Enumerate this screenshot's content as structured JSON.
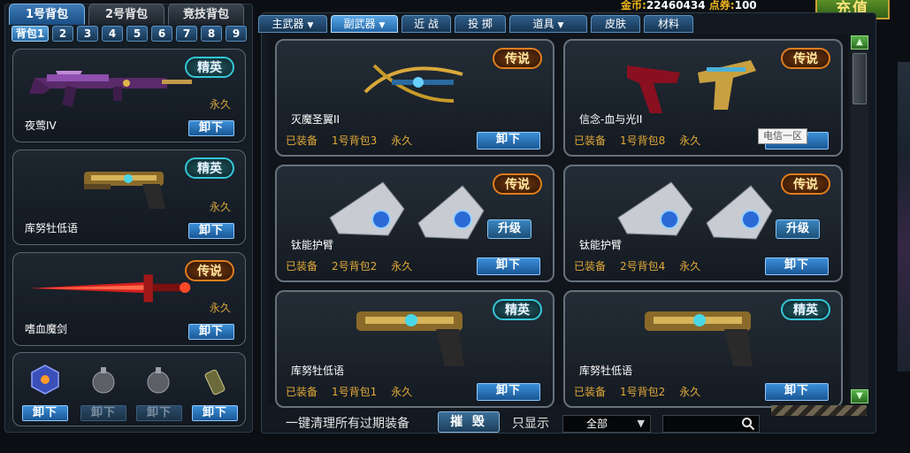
{
  "currency": {
    "gold_label": "金币:",
    "gold_value": "22460434",
    "points_label": "点券:",
    "points_value": "100",
    "topup_label": "充值"
  },
  "bag_tabs": [
    "1号背包",
    "2号背包",
    "竞技背包"
  ],
  "slot_tabs": [
    "背包1",
    "2",
    "3",
    "4",
    "5",
    "6",
    "7",
    "8",
    "9"
  ],
  "equipped": [
    {
      "name": "夜莺IV",
      "badge": "精英",
      "duration": "永久",
      "button": "卸下"
    },
    {
      "name": "库努牡低语",
      "badge": "精英",
      "duration": "永久",
      "button": "卸下"
    },
    {
      "name": "嗜血魔剑",
      "badge": "传说",
      "duration": "永久",
      "button": "卸下"
    }
  ],
  "throwables": {
    "buttons": [
      "卸下",
      "卸下",
      "卸下",
      "卸下"
    ]
  },
  "category_tabs": [
    {
      "label": "主武器",
      "has_arrow": true
    },
    {
      "label": "副武器",
      "has_arrow": true
    },
    {
      "label": "近 战",
      "has_arrow": false
    },
    {
      "label": "投 掷",
      "has_arrow": false
    },
    {
      "label": "道具",
      "has_arrow": true
    },
    {
      "label": "皮肤",
      "has_arrow": false
    },
    {
      "label": "材料",
      "has_arrow": false
    }
  ],
  "cards": [
    {
      "name": "灭魔圣翼II",
      "badge": "传说",
      "status": "已装备",
      "bag": "1号背包3",
      "duration": "永久",
      "button": "卸下"
    },
    {
      "name": "信念-血与光II",
      "badge": "传说",
      "status": "已装备",
      "bag": "1号背包8",
      "duration": "永久",
      "button": "卸下"
    },
    {
      "name": "钛能护臂",
      "badge": "传说",
      "status": "已装备",
      "bag": "2号背包2",
      "duration": "永久",
      "button": "卸下",
      "upgrade": "升级"
    },
    {
      "name": "钛能护臂",
      "badge": "传说",
      "status": "已装备",
      "bag": "2号背包4",
      "duration": "永久",
      "button": "卸下",
      "upgrade": "升级"
    },
    {
      "name": "库努牡低语",
      "badge": "精英",
      "status": "已装备",
      "bag": "1号背包1",
      "duration": "永久",
      "button": "卸下"
    },
    {
      "name": "库努牡低语",
      "badge": "精英",
      "status": "已装备",
      "bag": "1号背包2",
      "duration": "永久",
      "button": "卸下"
    }
  ],
  "tooltip": "电信一区",
  "bottom": {
    "clear_label": "一键清理所有过期装备",
    "destroy_button": "摧 毁",
    "filter_label": "只显示",
    "filter_value": "全部",
    "search_placeholder": ""
  }
}
